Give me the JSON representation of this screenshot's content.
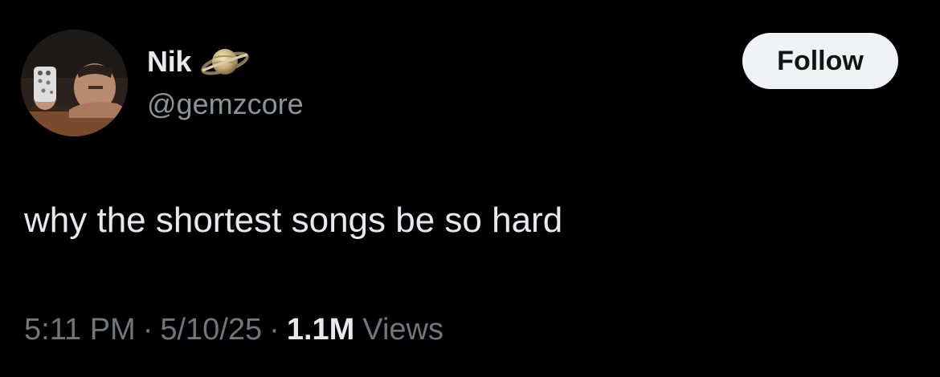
{
  "author": {
    "display_name": "Nik",
    "handle": "@gemzcore",
    "avatar_icon": "profile-photo-avatar",
    "badge_icon": "saturn-planet-icon"
  },
  "follow_button": {
    "label": "Follow"
  },
  "tweet": {
    "text": "why the shortest songs be so hard"
  },
  "meta": {
    "time": "5:11 PM",
    "separator": "·",
    "date": "5/10/25",
    "views_count": "1.1M",
    "views_label": "Views"
  },
  "colors": {
    "background": "#000000",
    "primary_text": "#e7e9ea",
    "secondary_text": "#71767b",
    "button_bg": "#eff3f4",
    "button_text": "#0f1419"
  }
}
